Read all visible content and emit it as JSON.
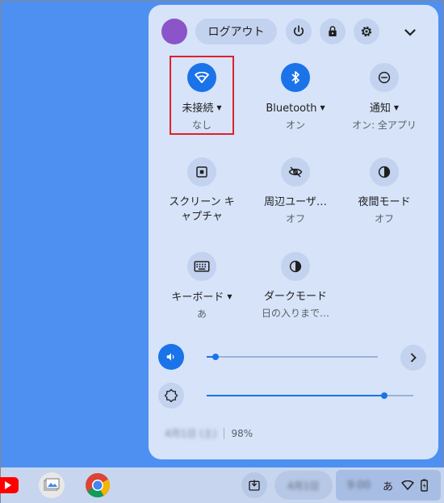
{
  "header": {
    "logout_label": "ログアウト"
  },
  "tiles": [
    {
      "label": "未接続",
      "sub": "なし",
      "icon": "wifi-icon",
      "active": true,
      "has_menu": true
    },
    {
      "label": "Bluetooth",
      "sub": "オン",
      "icon": "bluetooth-icon",
      "active": true,
      "has_menu": true
    },
    {
      "label": "通知",
      "sub": "オン: 全アプリ",
      "icon": "do-not-disturb-icon",
      "active": false,
      "has_menu": true
    },
    {
      "label": "スクリーン キ",
      "label2": "ャプチャ",
      "sub": "",
      "icon": "screen-capture-icon",
      "active": false,
      "has_menu": false
    },
    {
      "label": "周辺ユーザ…",
      "sub": "オフ",
      "icon": "privacy-eye-icon",
      "active": false,
      "has_menu": false
    },
    {
      "label": "夜間モード",
      "sub": "オフ",
      "icon": "night-light-icon",
      "active": false,
      "has_menu": false
    },
    {
      "label": "キーボード",
      "sub": "あ",
      "icon": "keyboard-icon",
      "active": false,
      "has_menu": true
    },
    {
      "label": "ダークモード",
      "sub": "日の入りまで…",
      "icon": "dark-mode-icon",
      "active": false,
      "has_menu": false
    }
  ],
  "sliders": {
    "volume_level": 0.05,
    "brightness_level": 0.86
  },
  "footer": {
    "date": "4月1日 (土)",
    "battery": "98%"
  },
  "shelf": {
    "date_pill": "4月1日",
    "time": "9:00",
    "ime": "あ"
  },
  "colors": {
    "desktop": "#4d90f1",
    "panel": "#d6e3f9",
    "accent": "#1a73e8",
    "highlight": "#e0202a"
  }
}
